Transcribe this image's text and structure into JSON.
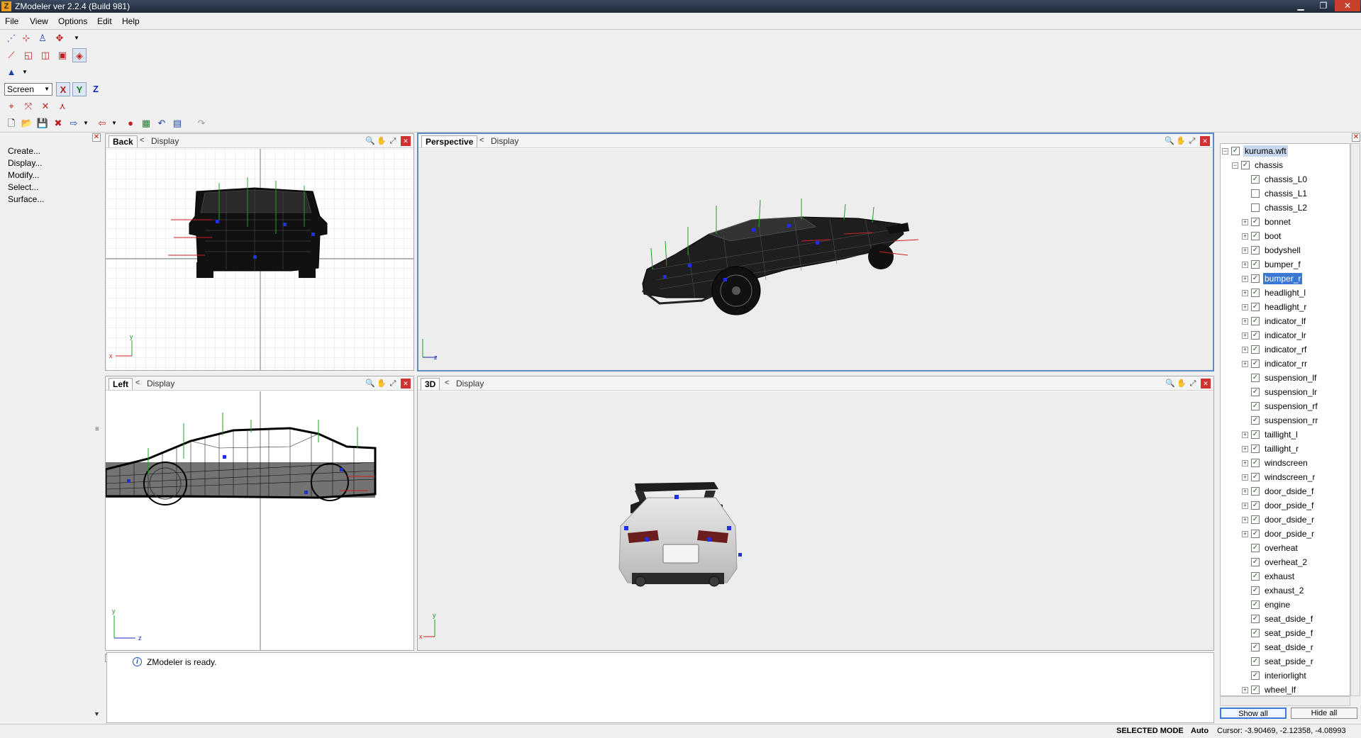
{
  "window": {
    "title": "ZModeler ver 2.2.4 (Build 981)",
    "icon": "Z",
    "controls": {
      "minimize": "▁",
      "maximize": "❐",
      "close": "✕"
    }
  },
  "menu": [
    "File",
    "View",
    "Options",
    "Edit",
    "Help"
  ],
  "toolbar": {
    "space_select": "Screen",
    "axes": [
      "X",
      "Y",
      "Z"
    ]
  },
  "left_panel": {
    "close": "✕",
    "commands": [
      "Create...",
      "Display...",
      "Modify...",
      "Select...",
      "Surface..."
    ]
  },
  "viewports": [
    {
      "name": "Back",
      "back": "<",
      "display": "Display",
      "axis_h": "x",
      "axis_v": "y",
      "active": false
    },
    {
      "name": "Perspective",
      "back": "<",
      "display": "Display",
      "axis_h": "z",
      "axis_v": "",
      "active": true
    },
    {
      "name": "Left",
      "back": "<",
      "display": "Display",
      "axis_h": "z",
      "axis_v": "y",
      "active": false
    },
    {
      "name": "3D",
      "back": "<",
      "display": "Display",
      "axis_h": "x",
      "axis_v": "y",
      "active": false
    }
  ],
  "log": {
    "message": "ZModeler is ready."
  },
  "scene_tree": {
    "nodes": [
      {
        "label": "kuruma.wft",
        "level": 0,
        "checked": true,
        "expander": "−",
        "root": true
      },
      {
        "label": "chassis",
        "level": 1,
        "checked": true,
        "expander": "−"
      },
      {
        "label": "chassis_L0",
        "level": 2,
        "checked": true,
        "expander": ""
      },
      {
        "label": "chassis_L1",
        "level": 2,
        "checked": false,
        "expander": ""
      },
      {
        "label": "chassis_L2",
        "level": 2,
        "checked": false,
        "expander": ""
      },
      {
        "label": "bonnet",
        "level": 2,
        "checked": true,
        "expander": "+"
      },
      {
        "label": "boot",
        "level": 2,
        "checked": true,
        "expander": "+"
      },
      {
        "label": "bodyshell",
        "level": 2,
        "checked": true,
        "expander": "+"
      },
      {
        "label": "bumper_f",
        "level": 2,
        "checked": true,
        "expander": "+"
      },
      {
        "label": "bumper_r",
        "level": 2,
        "checked": true,
        "expander": "+",
        "selected": true
      },
      {
        "label": "headlight_l",
        "level": 2,
        "checked": true,
        "expander": "+"
      },
      {
        "label": "headlight_r",
        "level": 2,
        "checked": true,
        "expander": "+"
      },
      {
        "label": "indicator_lf",
        "level": 2,
        "checked": true,
        "expander": "+"
      },
      {
        "label": "indicator_lr",
        "level": 2,
        "checked": true,
        "expander": "+"
      },
      {
        "label": "indicator_rf",
        "level": 2,
        "checked": true,
        "expander": "+"
      },
      {
        "label": "indicator_rr",
        "level": 2,
        "checked": true,
        "expander": "+"
      },
      {
        "label": "suspension_lf",
        "level": 2,
        "checked": true,
        "expander": ""
      },
      {
        "label": "suspension_lr",
        "level": 2,
        "checked": true,
        "expander": ""
      },
      {
        "label": "suspension_rf",
        "level": 2,
        "checked": true,
        "expander": ""
      },
      {
        "label": "suspension_rr",
        "level": 2,
        "checked": true,
        "expander": ""
      },
      {
        "label": "taillight_l",
        "level": 2,
        "checked": true,
        "expander": "+"
      },
      {
        "label": "taillight_r",
        "level": 2,
        "checked": true,
        "expander": "+"
      },
      {
        "label": "windscreen",
        "level": 2,
        "checked": true,
        "expander": "+"
      },
      {
        "label": "windscreen_r",
        "level": 2,
        "checked": true,
        "expander": "+"
      },
      {
        "label": "door_dside_f",
        "level": 2,
        "checked": true,
        "expander": "+"
      },
      {
        "label": "door_pside_f",
        "level": 2,
        "checked": true,
        "expander": "+"
      },
      {
        "label": "door_dside_r",
        "level": 2,
        "checked": true,
        "expander": "+"
      },
      {
        "label": "door_pside_r",
        "level": 2,
        "checked": true,
        "expander": "+"
      },
      {
        "label": "overheat",
        "level": 2,
        "checked": true,
        "expander": ""
      },
      {
        "label": "overheat_2",
        "level": 2,
        "checked": true,
        "expander": ""
      },
      {
        "label": "exhaust",
        "level": 2,
        "checked": true,
        "expander": ""
      },
      {
        "label": "exhaust_2",
        "level": 2,
        "checked": true,
        "expander": ""
      },
      {
        "label": "engine",
        "level": 2,
        "checked": true,
        "expander": ""
      },
      {
        "label": "seat_dside_f",
        "level": 2,
        "checked": true,
        "expander": ""
      },
      {
        "label": "seat_pside_f",
        "level": 2,
        "checked": true,
        "expander": ""
      },
      {
        "label": "seat_dside_r",
        "level": 2,
        "checked": true,
        "expander": ""
      },
      {
        "label": "seat_pside_r",
        "level": 2,
        "checked": true,
        "expander": ""
      },
      {
        "label": "interiorlight",
        "level": 2,
        "checked": true,
        "expander": ""
      },
      {
        "label": "wheel_lf",
        "level": 2,
        "checked": true,
        "expander": "+"
      }
    ],
    "buttons": {
      "show_all": "Show all",
      "hide_all": "Hide all"
    }
  },
  "status": {
    "mode": "SELECTED MODE",
    "auto": "Auto",
    "cursor": "Cursor: -3.90469, -2.12358, -4.08993"
  },
  "colors": {
    "accent": "#3a78d4",
    "active_viewport": "#5c8cc8",
    "close_red": "#d03030"
  }
}
